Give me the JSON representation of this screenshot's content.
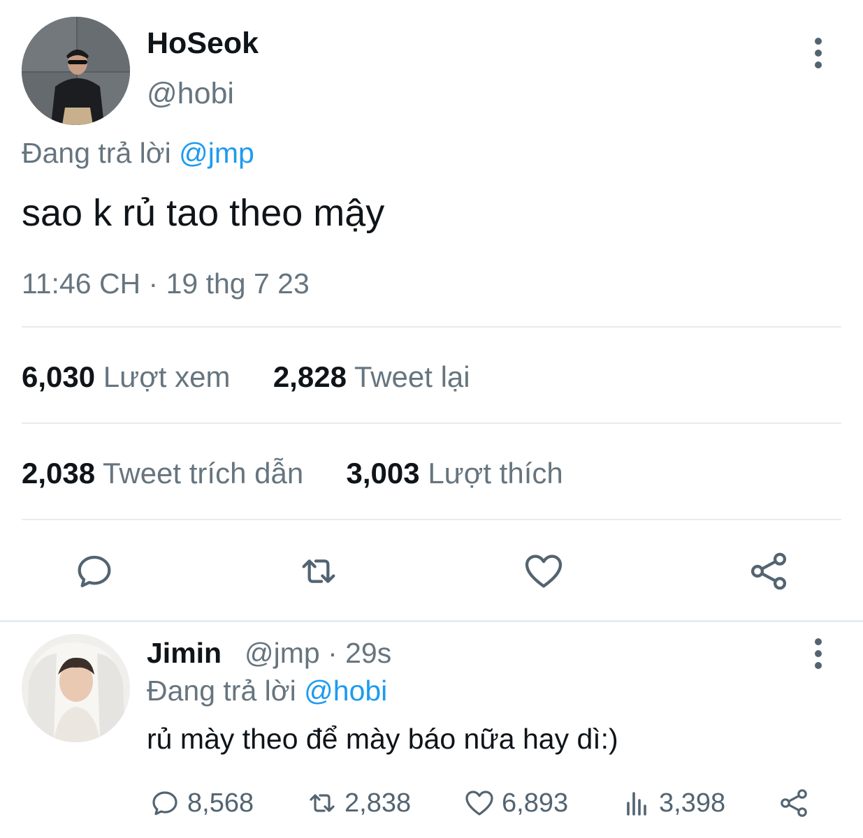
{
  "main_tweet": {
    "author_name": "HoSeok",
    "author_handle": "@hobi",
    "replying_prefix": "Đang trả lời",
    "replying_to": "@jmp",
    "text": "sao k rủ tao theo mậy",
    "timestamp": "11:46 CH · 19 thg 7 23",
    "stats": {
      "views_count": "6,030",
      "views_label": "Lượt xem",
      "retweets_count": "2,828",
      "retweets_label": "Tweet lại",
      "quotes_count": "2,038",
      "quotes_label": "Tweet trích dẫn",
      "likes_count": "3,003",
      "likes_label": "Lượt thích"
    },
    "actions": [
      "reply-icon",
      "retweet-icon",
      "like-icon",
      "share-icon"
    ]
  },
  "reply_tweet": {
    "author_name": "Jimin",
    "author_handle_time": "@jmp · 29s",
    "replying_prefix": "Đang trả lời",
    "replying_to": "@hobi",
    "text": "rủ mày theo để mày báo nữa hay dì:)",
    "counts": {
      "replies": "8,568",
      "retweets": "2,838",
      "likes": "6,893",
      "views": "3,398"
    }
  },
  "colors": {
    "accent": "#1d9bf0",
    "text_primary": "#0f1419",
    "text_secondary": "#66757f",
    "icon": "#536471",
    "divider": "#e6ecf0"
  }
}
